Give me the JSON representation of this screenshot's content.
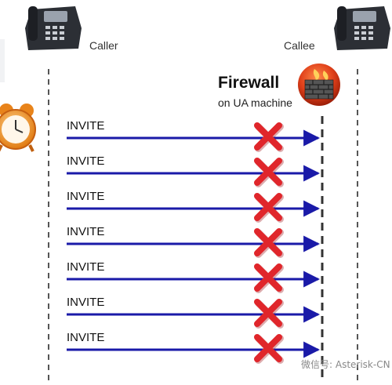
{
  "caller": {
    "label": "Caller"
  },
  "callee": {
    "label": "Callee"
  },
  "firewall": {
    "title": "Firewall",
    "subtitle": "on UA machine"
  },
  "messages": [
    {
      "label": "INVITE",
      "blocked": true
    },
    {
      "label": "INVITE",
      "blocked": true
    },
    {
      "label": "INVITE",
      "blocked": true
    },
    {
      "label": "INVITE",
      "blocked": true
    },
    {
      "label": "INVITE",
      "blocked": true
    },
    {
      "label": "INVITE",
      "blocked": true
    },
    {
      "label": "INVITE",
      "blocked": true
    }
  ],
  "watermark": {
    "text": "微信号: Asterisk-CN"
  },
  "icons": [
    "desk-phone-icon",
    "alarm-clock-icon",
    "firewall-icon",
    "cross-icon"
  ],
  "colors": {
    "arrow": "#1a1aa8",
    "cross": "#e0262b",
    "lifeline": "#555555",
    "firewall": "#d43a1a"
  }
}
